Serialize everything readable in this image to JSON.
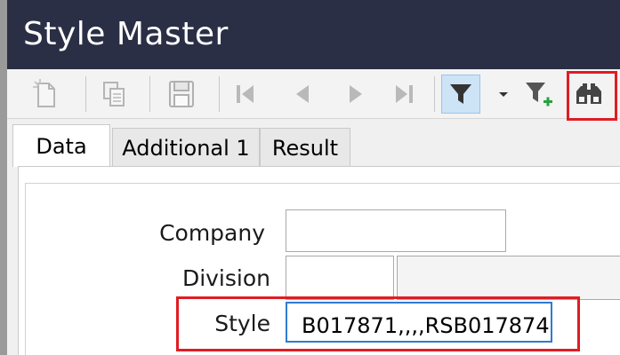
{
  "window": {
    "title": "Style Master"
  },
  "toolbar": {
    "buttons": [
      {
        "name": "new-record",
        "icon": "new-document-icon",
        "enabled": false
      },
      {
        "name": "copy-record",
        "icon": "copy-icon",
        "enabled": false
      },
      {
        "name": "save",
        "icon": "save-icon",
        "enabled": false
      },
      {
        "name": "first",
        "icon": "first-record-icon",
        "enabled": false
      },
      {
        "name": "previous",
        "icon": "previous-record-icon",
        "enabled": false
      },
      {
        "name": "next",
        "icon": "next-record-icon",
        "enabled": false
      },
      {
        "name": "last",
        "icon": "last-record-icon",
        "enabled": false
      },
      {
        "name": "filter",
        "icon": "filter-icon",
        "enabled": true,
        "active": true
      },
      {
        "name": "filter-options",
        "icon": "dropdown-arrow-icon",
        "enabled": true
      },
      {
        "name": "add-filter",
        "icon": "filter-add-icon",
        "enabled": true
      },
      {
        "name": "find",
        "icon": "binoculars-icon",
        "enabled": true,
        "highlighted": true
      }
    ]
  },
  "tabs": [
    {
      "label": "Data",
      "active": true
    },
    {
      "label": "Additional 1",
      "active": false
    },
    {
      "label": "Result",
      "active": false
    }
  ],
  "form": {
    "company": {
      "label": "Company",
      "value": ""
    },
    "division": {
      "label": "Division",
      "value": ""
    },
    "style": {
      "label": "Style",
      "value": "B017871,,,,RSB017874"
    }
  },
  "colors": {
    "titlebar": "#2b2f45",
    "highlight": "#e01c24",
    "focus_border": "#2f7bd0",
    "active_button": "#cde3f6"
  }
}
